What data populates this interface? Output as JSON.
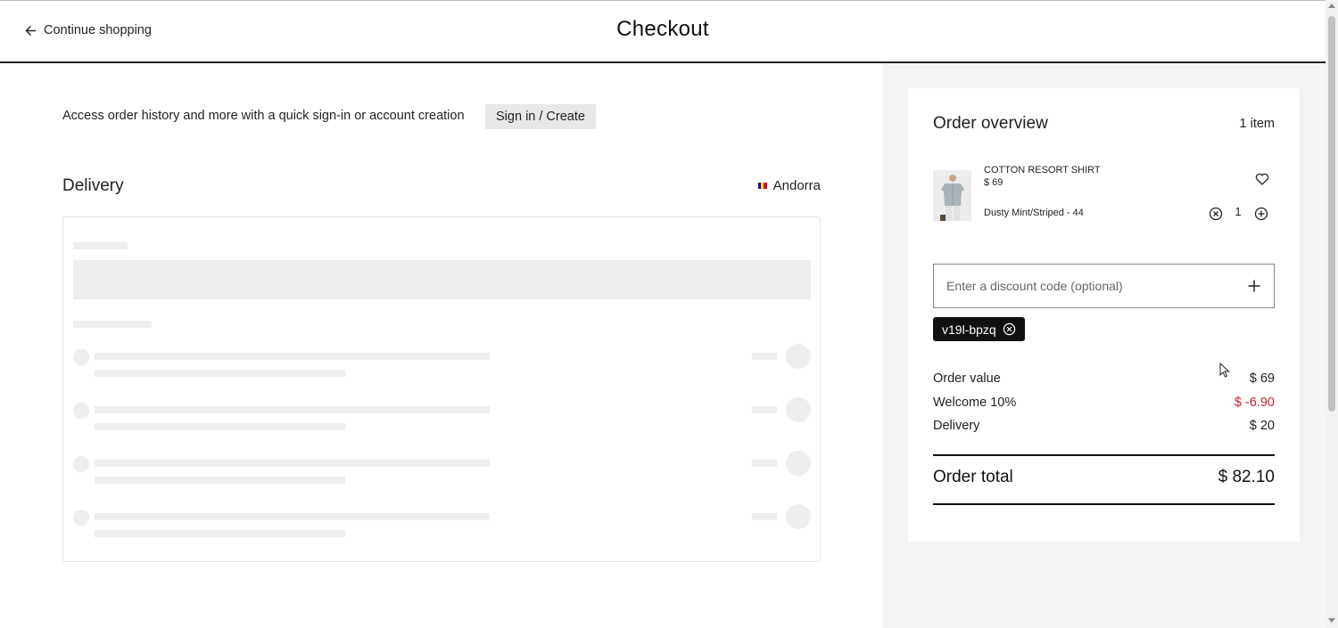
{
  "header": {
    "back_label": "Continue shopping",
    "title": "Checkout"
  },
  "account": {
    "prompt": "Access order history and more with a quick sign-in or account creation",
    "button_label": "Sign in / Create"
  },
  "delivery": {
    "title": "Delivery",
    "country": "Andorra",
    "flag_colors": [
      "#10069f",
      "#fedd00",
      "#d50032"
    ],
    "loading": true
  },
  "order_overview": {
    "title": "Order overview",
    "item_count": "1 item",
    "items": [
      {
        "name": "COTTON RESORT SHIRT",
        "price": "$ 69",
        "variant": "Dusty Mint/Striped - 44",
        "quantity": "1"
      }
    ],
    "discount": {
      "placeholder": "Enter a discount code (optional)",
      "value": "",
      "applied_code": "v19l-bpzq"
    },
    "summary": {
      "order_value_label": "Order value",
      "order_value": "$ 69",
      "discount_label": "Welcome 10%",
      "discount_value": "$ -6.90",
      "delivery_label": "Delivery",
      "delivery_value": "$ 20",
      "total_label": "Order total",
      "total_value": "$ 82.10"
    }
  },
  "colors": {
    "accent_dark": "#111111",
    "discount_red": "#c8202b",
    "sidebar_bg": "#f4f4f4"
  }
}
